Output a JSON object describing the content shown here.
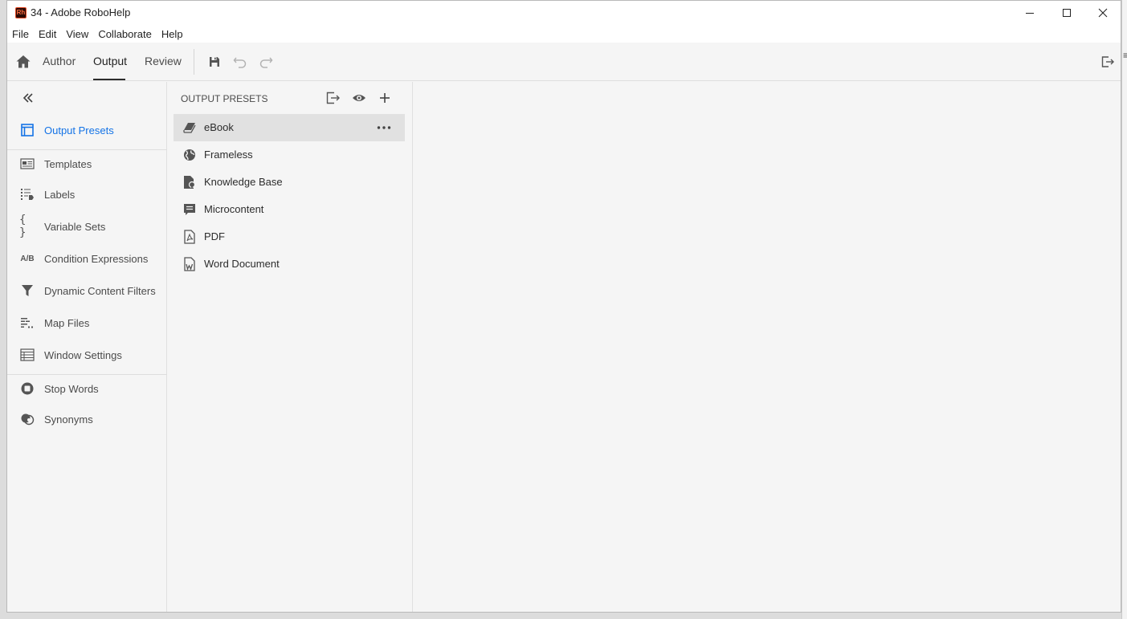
{
  "window": {
    "app_icon_text": "Rh",
    "title": "34 - Adobe RoboHelp"
  },
  "menu": {
    "items": [
      "File",
      "Edit",
      "View",
      "Collaborate",
      "Help"
    ]
  },
  "toolbar": {
    "tabs": [
      "Author",
      "Output",
      "Review"
    ],
    "active_tab": "Output"
  },
  "left_nav": {
    "items": [
      {
        "label": "Output Presets",
        "icon": "output-presets-icon",
        "active": true
      },
      {
        "label": "Templates",
        "icon": "templates-icon"
      },
      {
        "label": "Labels",
        "icon": "labels-icon"
      },
      {
        "label": "Variable Sets",
        "icon": "variable-sets-icon"
      },
      {
        "label": "Condition Expressions",
        "icon": "condition-expressions-icon",
        "icon_text": "A/B"
      },
      {
        "label": "Dynamic Content Filters",
        "icon": "filter-icon"
      },
      {
        "label": "Map Files",
        "icon": "map-files-icon"
      },
      {
        "label": "Window Settings",
        "icon": "window-settings-icon"
      },
      {
        "label": "Stop Words",
        "icon": "stop-words-icon"
      },
      {
        "label": "Synonyms",
        "icon": "synonyms-icon"
      }
    ]
  },
  "presets_panel": {
    "title": "OUTPUT PRESETS",
    "items": [
      {
        "label": "eBook",
        "icon": "ebook-icon",
        "selected": true
      },
      {
        "label": "Frameless",
        "icon": "globe-icon"
      },
      {
        "label": "Knowledge Base",
        "icon": "knowledge-base-icon"
      },
      {
        "label": "Microcontent",
        "icon": "microcontent-icon"
      },
      {
        "label": "PDF",
        "icon": "pdf-icon"
      },
      {
        "label": "Word Document",
        "icon": "word-document-icon"
      }
    ]
  },
  "colors": {
    "accent": "#1473e6",
    "selection": "#e1e1e1",
    "background": "#f5f5f5"
  }
}
